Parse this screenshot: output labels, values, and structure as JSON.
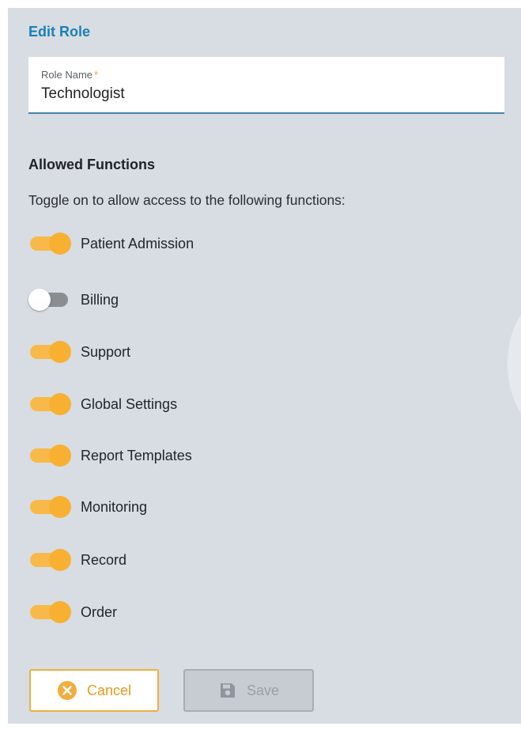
{
  "page": {
    "title": "Edit Role"
  },
  "role_field": {
    "label": "Role Name",
    "required_mark": "*",
    "value": "Technologist"
  },
  "functions": {
    "title": "Allowed Functions",
    "description": "Toggle on to allow access to the following functions:",
    "items": [
      {
        "label": "Patient Admission",
        "enabled": true
      },
      {
        "label": "Billing",
        "enabled": false
      },
      {
        "label": "Support",
        "enabled": true
      },
      {
        "label": "Global Settings",
        "enabled": true
      },
      {
        "label": "Report Templates",
        "enabled": true
      },
      {
        "label": "Monitoring",
        "enabled": true
      },
      {
        "label": "Record",
        "enabled": true
      },
      {
        "label": "Order",
        "enabled": true
      }
    ]
  },
  "actions": {
    "cancel_label": "Cancel",
    "save_label": "Save",
    "save_enabled": false
  },
  "colors": {
    "accent": "#f8b033",
    "title": "#1a7fb8",
    "panel": "#d8dde3"
  },
  "icons": {
    "cancel": "close-circle-icon",
    "save": "floppy-disk-icon"
  }
}
